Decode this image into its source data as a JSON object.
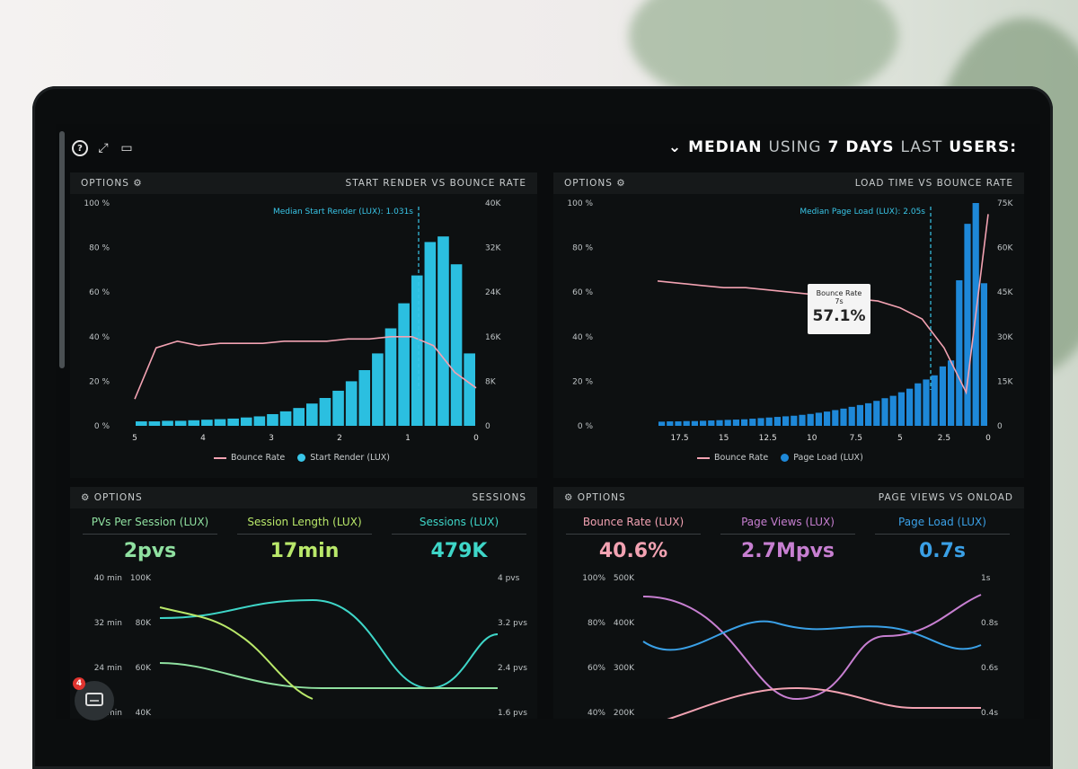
{
  "header": {
    "title_users": "USERS:",
    "title_last": "LAST",
    "title_seven": "7 DAYS",
    "title_using": "USING",
    "title_median": "MEDIAN"
  },
  "panels": {
    "load_time": {
      "title": "LOAD TIME VS BOUNCE RATE",
      "options": "OPTIONS",
      "median_label": "Median Page Load (LUX): 2.05s",
      "tooltip": {
        "title": "Bounce Rate",
        "sub": "7s",
        "value": "57.1%"
      },
      "legend": {
        "bars": "Page Load (LUX)",
        "line": "Bounce Rate"
      }
    },
    "start_render": {
      "title": "START RENDER VS BOUNCE RATE",
      "options": "OPTIONS",
      "median_label": "Median Start Render (LUX): 1.031s",
      "legend": {
        "bars": "Start Render (LUX)",
        "line": "Bounce Rate"
      }
    },
    "page_views": {
      "title": "PAGE VIEWS VS ONLOAD",
      "options": "OPTIONS",
      "metrics": [
        {
          "label": "Page Load (LUX)",
          "value": "0.7s",
          "color": "#3aa0e6"
        },
        {
          "label": "Page Views (LUX)",
          "value": "2.7Mpvs",
          "color": "#c77fd1"
        },
        {
          "label": "Bounce Rate (LUX)",
          "value": "40.6%",
          "color": "#f2a2b2"
        }
      ]
    },
    "sessions": {
      "title": "SESSIONS",
      "options": "OPTIONS",
      "metrics": [
        {
          "label": "Sessions (LUX)",
          "value": "479K",
          "color": "#3ed6c8"
        },
        {
          "label": "Session Length (LUX)",
          "value": "17min",
          "color": "#b9e86a"
        },
        {
          "label": "PVs Per Session (LUX)",
          "value": "2pvs",
          "color": "#8fe0a0"
        }
      ]
    }
  },
  "chat": {
    "badge": "4"
  },
  "chart_data": [
    {
      "type": "bar",
      "title": "LOAD TIME VS BOUNCE RATE",
      "x_ticks": [
        "0",
        "2.5",
        "5",
        "7.5",
        "10",
        "12.5",
        "15",
        "17.5"
      ],
      "y_left_ticks": [
        "100 %",
        "80 %",
        "60 %",
        "40 %",
        "20 %",
        "0 %"
      ],
      "y_right_ticks": [
        "75K",
        "60K",
        "45K",
        "30K",
        "15K",
        "0"
      ],
      "bars": [
        48,
        75,
        68,
        49,
        22,
        20,
        17,
        15.6,
        14.3,
        12.5,
        11.3,
        10.1,
        9.3,
        8.4,
        7.6,
        7,
        6.4,
        5.8,
        5.3,
        4.8,
        4.4,
        4,
        3.7,
        3.4,
        3.2,
        3,
        2.8,
        2.6,
        2.4,
        2.2,
        2.1,
        2,
        1.9,
        1.8,
        1.7,
        1.6,
        1.6,
        1.5,
        1.5,
        1.4
      ],
      "bounce_rate": [
        95,
        15,
        35,
        48,
        53,
        56,
        57,
        58,
        59,
        60,
        61,
        62,
        62,
        63,
        64,
        65
      ]
    },
    {
      "type": "bar",
      "title": "START RENDER VS BOUNCE RATE",
      "x_ticks": [
        "0",
        "1",
        "2",
        "3",
        "4",
        "5"
      ],
      "y_left_ticks": [
        "100 %",
        "80 %",
        "60 %",
        "40 %",
        "20 %",
        "0 %"
      ],
      "y_right_ticks": [
        "40K",
        "32K",
        "24K",
        "16K",
        "8K",
        "0"
      ],
      "bars": [
        13,
        29,
        34,
        33,
        27,
        22,
        17.5,
        13,
        10,
        8,
        6.3,
        5,
        4,
        3.2,
        2.6,
        2.1,
        1.7,
        1.5,
        1.3,
        1.2,
        1.1,
        1.0,
        0.9,
        0.9,
        0.8,
        0.8
      ],
      "bounce_rate": [
        17,
        24,
        36,
        40,
        40,
        39,
        39,
        38,
        38,
        38,
        37,
        37,
        37,
        36,
        38,
        35,
        12
      ]
    },
    {
      "type": "line",
      "title": "PAGE VIEWS VS ONLOAD",
      "y_left_ticks": [
        "1s",
        "0.8s",
        "0.6s",
        "0.4s"
      ],
      "y_mid_ticks": [
        "500K",
        "400K",
        "300K",
        "200K"
      ],
      "y_right_ticks": [
        "100%",
        "80%",
        "60%",
        "40%"
      ]
    },
    {
      "type": "line",
      "title": "SESSIONS",
      "y_left_ticks": [
        "4 pvs",
        "3.2 pvs",
        "2.4 pvs",
        "1.6 pvs"
      ],
      "y_mid_ticks": [
        "100K",
        "80K",
        "60K",
        "40K"
      ],
      "y_right_ticks": [
        "40 min",
        "32 min",
        "24 min",
        "16 min"
      ]
    }
  ]
}
